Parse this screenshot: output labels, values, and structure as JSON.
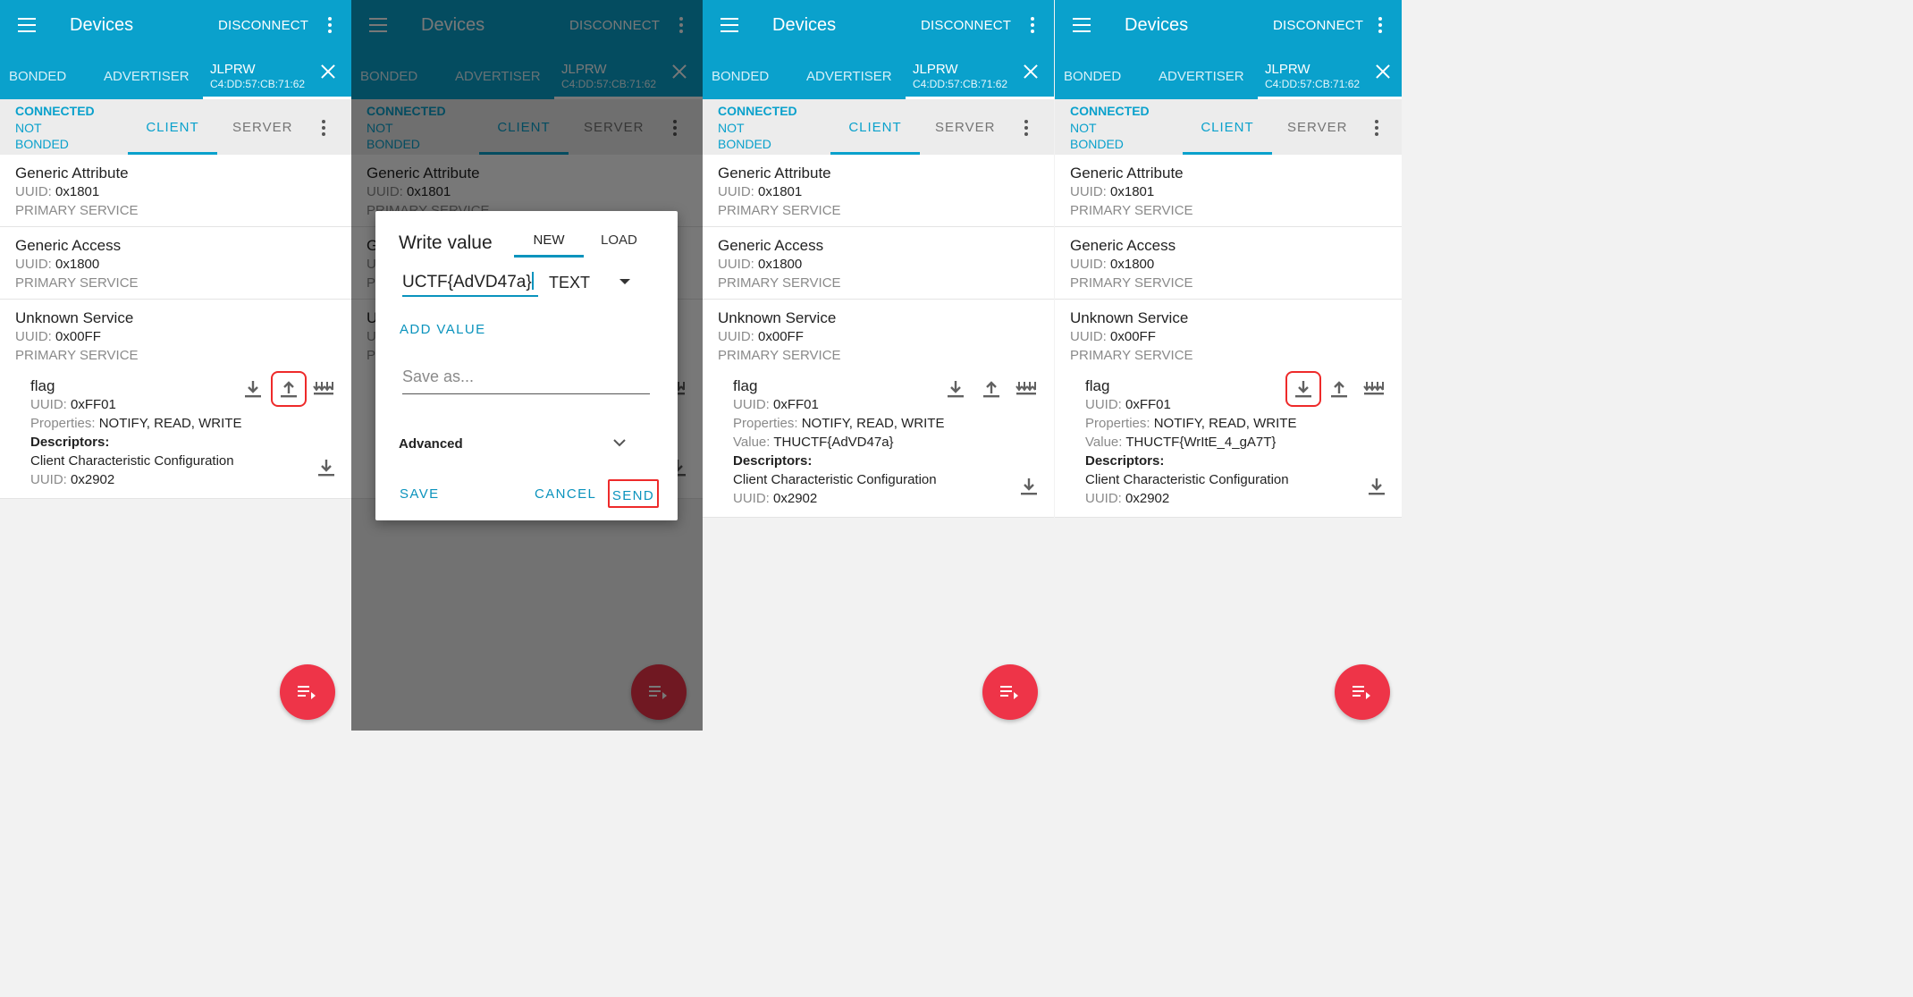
{
  "toolbar": {
    "title": "Devices",
    "disconnect": "DISCONNECT"
  },
  "device_tabs": {
    "bonded": "BONDED",
    "advertiser": "ADVERTISER",
    "device_name": "JLPRW",
    "device_address": "C4:DD:57:CB:71:62"
  },
  "status": {
    "connected": "CONNECTED",
    "bond_state": "NOT BONDED",
    "client_tab": "CLIENT",
    "server_tab": "SERVER"
  },
  "labels": {
    "uuid": "UUID:",
    "properties": "Properties:",
    "value": "Value:",
    "descriptors": "Descriptors:"
  },
  "services": [
    {
      "name": "Generic Attribute",
      "uuid": "0x1801",
      "type": "PRIMARY SERVICE"
    },
    {
      "name": "Generic Access",
      "uuid": "0x1800",
      "type": "PRIMARY SERVICE"
    },
    {
      "name": "Unknown Service",
      "uuid": "0x00FF",
      "type": "PRIMARY SERVICE"
    }
  ],
  "characteristic": {
    "name": "flag",
    "uuid": "0xFF01",
    "properties": "NOTIFY, READ, WRITE",
    "descriptor_name": "Client Characteristic Configuration",
    "descriptor_uuid": "0x2902"
  },
  "values": {
    "panel3": "THUCTF{AdVD47a}",
    "panel4": "THUCTF{WrItE_4_gA7T}"
  },
  "dialog": {
    "title": "Write value",
    "tab_new": "NEW",
    "tab_load": "LOAD",
    "input_value": "UCTF{AdVD47a}",
    "type": "TEXT",
    "add_value": "ADD VALUE",
    "save_as_placeholder": "Save as...",
    "advanced": "Advanced",
    "save": "SAVE",
    "cancel": "CANCEL",
    "send": "SEND"
  },
  "colors": {
    "accent": "#0aa1cc",
    "fab": "#ee3448",
    "highlight": "#ee2a2a"
  },
  "icons": {
    "menu": "hamburger-menu-icon",
    "read": "download-arrow-icon",
    "write": "upload-arrow-icon",
    "notify": "multiple-down-arrows-icon",
    "fab": "log-list-icon"
  }
}
